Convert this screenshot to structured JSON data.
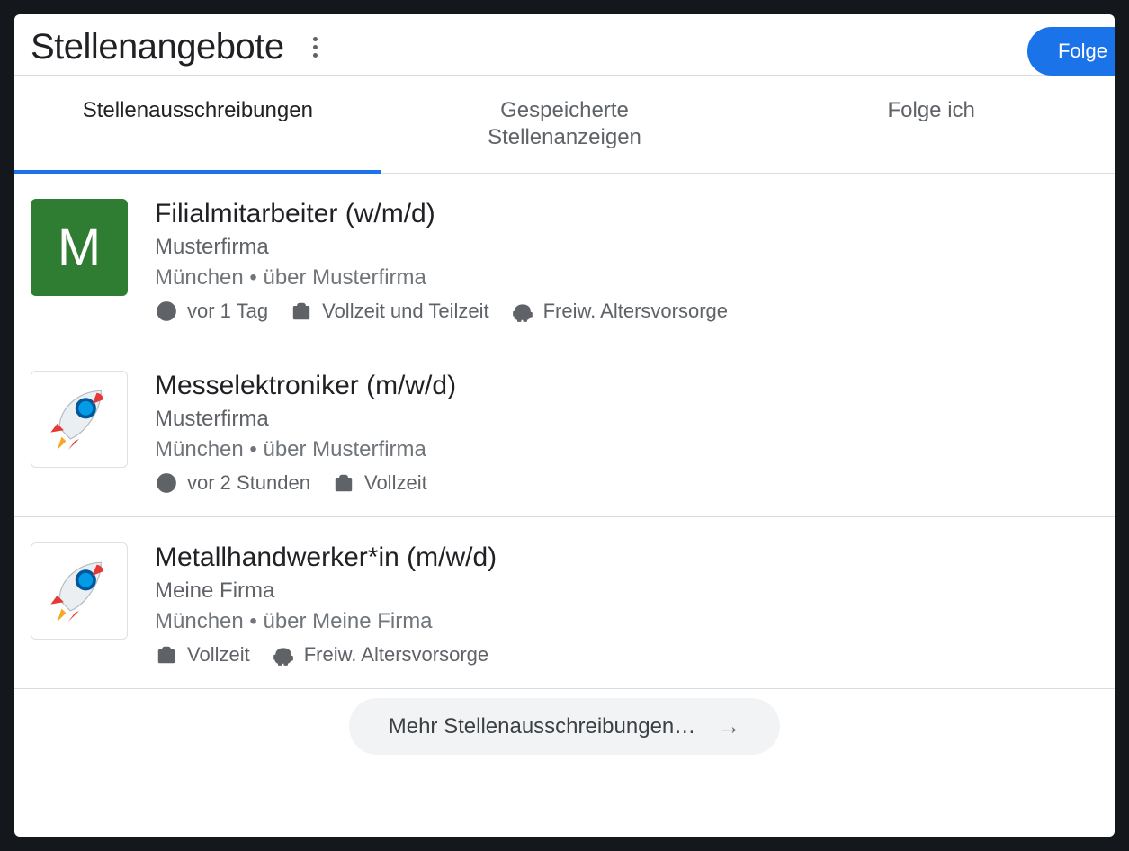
{
  "header": {
    "title": "Stellenangebote",
    "follow_label": "Folge"
  },
  "tabs": [
    {
      "label": "Stellenausschreibungen",
      "active": true
    },
    {
      "label": "Gespeicherte\nStellenanzeigen",
      "active": false
    },
    {
      "label": "Folge ich",
      "active": false
    }
  ],
  "jobs": [
    {
      "logo": {
        "type": "letter",
        "letter": "M",
        "bg": "#2e7d32"
      },
      "title": "Filialmitarbeiter (w/m/d)",
      "company": "Musterfirma",
      "location": "München • über Musterfirma",
      "tags": [
        {
          "icon": "clock",
          "text": "vor 1 Tag"
        },
        {
          "icon": "briefcase",
          "text": "Vollzeit und Teilzeit"
        },
        {
          "icon": "piggy",
          "text": "Freiw. Altersvorsorge"
        }
      ]
    },
    {
      "logo": {
        "type": "rocket"
      },
      "title": "Messelektroniker (m/w/d)",
      "company": "Musterfirma",
      "location": "München • über Musterfirma",
      "tags": [
        {
          "icon": "clock",
          "text": "vor 2 Stunden"
        },
        {
          "icon": "briefcase",
          "text": "Vollzeit"
        }
      ]
    },
    {
      "logo": {
        "type": "rocket"
      },
      "title": "Metallhandwerker*in (m/w/d)",
      "company": "Meine Firma",
      "location": "München • über Meine Firma",
      "tags": [
        {
          "icon": "briefcase",
          "text": "Vollzeit"
        },
        {
          "icon": "piggy",
          "text": "Freiw. Altersvorsorge"
        }
      ]
    }
  ],
  "more_label": "Mehr Stellenausschreibungen…"
}
